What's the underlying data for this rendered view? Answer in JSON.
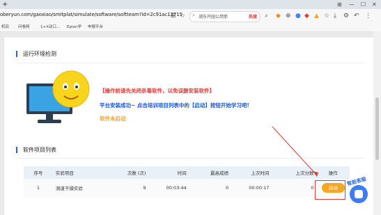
{
  "browser": {
    "url": "oberyun.com/gaoxiao/smitplat/simulate/software/softteam?id=2c91ac12715",
    "search_text": "湖东开园公用耶",
    "search_hot": "热搜",
    "bookmarks": [
      "机后",
      "问卷网",
      "1+X动口…",
      "Eplan学",
      "申报平台"
    ]
  },
  "env_section": {
    "title": "运行环境检测",
    "warning": "【操作前请先关闭杀毒软件，以免误删安装软件】",
    "success": "平台安装成功~ 点击培训项目列表中的【启动】按钮开始学习吧!",
    "status": "软件未启动"
  },
  "project_section": {
    "title": "软件项目列表",
    "columns": [
      "序号",
      "实验项目",
      "次数 (次)",
      "时间",
      "最高成绩",
      "上次时间",
      "上次分数",
      "操作"
    ],
    "rows": [
      {
        "index": "1",
        "project": "洞道干燥实验",
        "count": "9",
        "time": "00:03:44",
        "best": "0",
        "last_time": "00:00:17",
        "last_score": "0",
        "action": "启动"
      }
    ]
  },
  "assistant": {
    "label": "智能客服"
  },
  "colors": {
    "accent": "#2f5fd3",
    "warning": "#e53935",
    "success": "#1a56d6",
    "status": "#f5a623",
    "start_button": "#f5a623"
  }
}
